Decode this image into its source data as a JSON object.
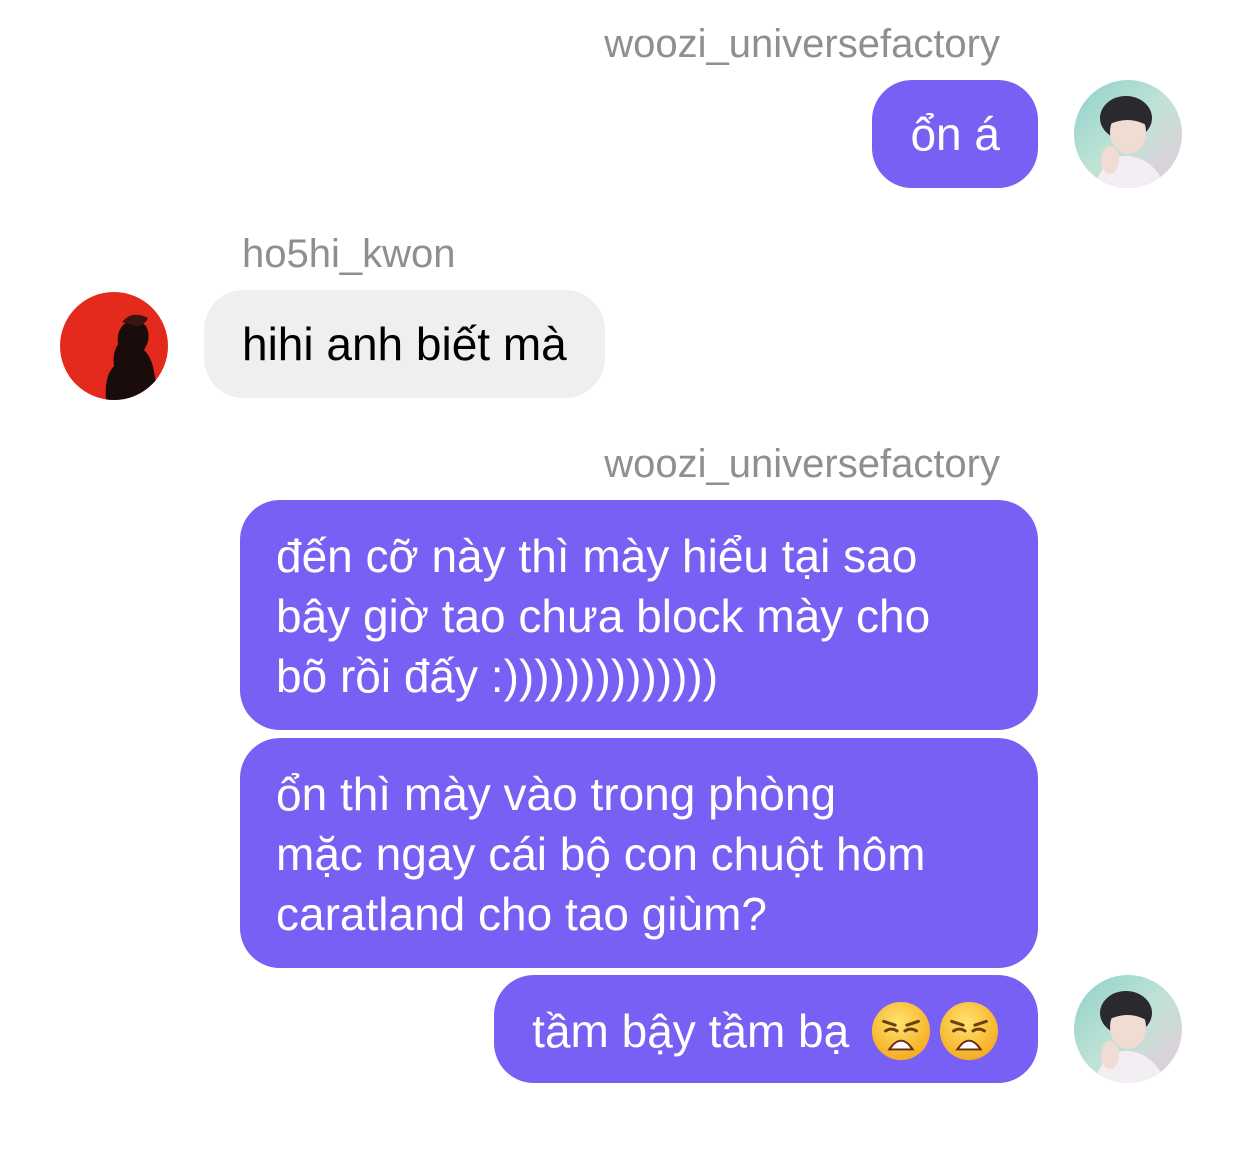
{
  "messages": [
    {
      "sender": "woozi_universefactory",
      "side": "right",
      "text": "ổn á"
    },
    {
      "sender": "ho5hi_kwon",
      "side": "left",
      "text": "hihi anh biết mà"
    },
    {
      "sender": "woozi_universefactory",
      "side": "right",
      "text": "đến cỡ này thì mày hiểu tại sao\nbây giờ tao chưa block mày cho\nbõ rồi đấy :))))))))))))))"
    },
    {
      "sender": "woozi_universefactory",
      "side": "right",
      "text": "ổn thì mày vào trong phòng\nmặc ngay cái bộ con chuột hôm\ncaratland cho tao giùm?"
    },
    {
      "sender": "woozi_universefactory",
      "side": "right",
      "text": "tầm bậy tầm bạ",
      "emojis": [
        "weary-face-icon",
        "weary-face-icon"
      ]
    }
  ],
  "colors": {
    "outgoing_bubble": "#7960f4",
    "incoming_bubble": "#efefef",
    "username_text": "#8e8e93"
  }
}
